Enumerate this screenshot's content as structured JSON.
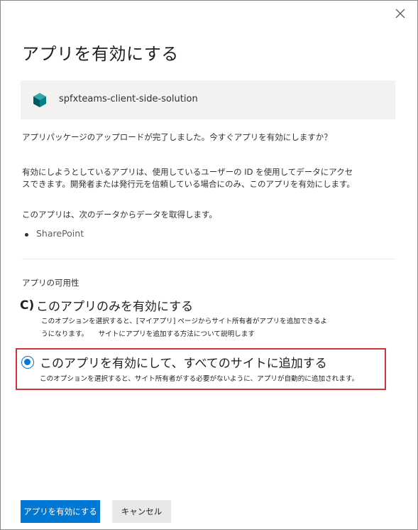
{
  "dialog": {
    "title": "アプリを有効にする",
    "solution_name": "spfxteams-client-side-solution",
    "upload_complete": "アプリパッケージのアップロードが完了しました。今すぐアプリを有効にしますか？",
    "warning_line1": "有効にしようとしているアプリは、使用しているユーザーの ID を使用してデータにアクセ",
    "warning_line2": "スできます。開発者または発行元を信頼している場合にのみ、このアプリを有効にします。",
    "data_sources_intro": "このアプリは、次のデータからデータを取得します。",
    "data_sources": [
      "SharePoint"
    ],
    "availability_label": "アプリの可用性",
    "option1": {
      "marker": "C)",
      "label": "このアプリのみを有効にする",
      "desc_line1": "このオプションを選択すると、[マイアプリ] ページからサイト所有者がアプリを追加できるよ",
      "desc_line2": "うになります。　　サイトにアプリを追加する方法について説明します"
    },
    "option2": {
      "label": "このアプリを有効にして、すべてのサイトに追加する",
      "desc": "このオプションを選択すると、サイト所有者がする必要がないように、アプリが自動的に追加されます。",
      "selected": true
    },
    "buttons": {
      "enable": "アプリを有効にする",
      "cancel": "キャンセル"
    }
  },
  "colors": {
    "accent": "#0078d4",
    "highlight_border": "#d13438",
    "solution_icon": "#038387"
  },
  "icons": {
    "close": "close-icon",
    "solution": "package-icon"
  }
}
